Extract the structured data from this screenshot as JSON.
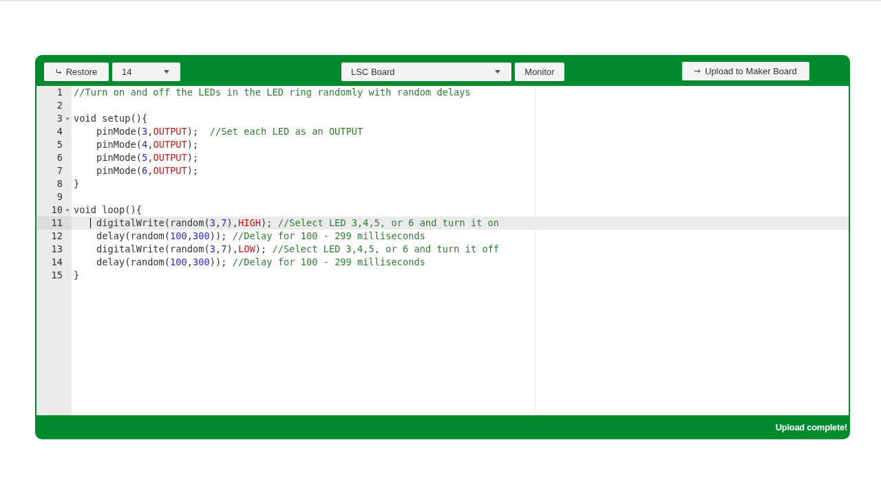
{
  "toolbar": {
    "restore_button": "Restore",
    "line_select": "14",
    "board_select": "LSC Board",
    "monitor_button": "Monitor",
    "upload_button": "Upload to Maker Board"
  },
  "editor": {
    "lines": [
      {
        "number": "1",
        "selected": false,
        "tokens": [
          {
            "text": "//Turn on and off the LEDs in the LED ring randomly with random delays",
            "kind": "comment"
          }
        ]
      },
      {
        "number": "2",
        "selected": false
      },
      {
        "number": "3",
        "selected": false,
        "expanded": true,
        "tokens": [
          {
            "text": "void setup(){",
            "kind": "plain"
          }
        ]
      },
      {
        "number": "4",
        "selected": false,
        "tokens": [
          {
            "text": "    pinMode(",
            "kind": "plain"
          },
          {
            "text": "3",
            "kind": "number"
          },
          {
            "text": ",",
            "kind": "plain"
          },
          {
            "text": "OUTPUT",
            "kind": "constant"
          },
          {
            "text": ");  ",
            "kind": "plain"
          },
          {
            "text": "//Set each LED as an OUTPUT",
            "kind": "comment"
          }
        ]
      },
      {
        "number": "5",
        "selected": false,
        "tokens": [
          {
            "text": "    pinMode(",
            "kind": "plain"
          },
          {
            "text": "4",
            "kind": "number"
          },
          {
            "text": ",",
            "kind": "plain"
          },
          {
            "text": "OUTPUT",
            "kind": "constant"
          },
          {
            "text": ");",
            "kind": "plain"
          }
        ]
      },
      {
        "number": "6",
        "selected": false,
        "tokens": [
          {
            "text": "    pinMode(",
            "kind": "plain"
          },
          {
            "text": "5",
            "kind": "number"
          },
          {
            "text": ",",
            "kind": "plain"
          },
          {
            "text": "OUTPUT",
            "kind": "constant"
          },
          {
            "text": ");",
            "kind": "plain"
          }
        ]
      },
      {
        "number": "7",
        "selected": false,
        "tokens": [
          {
            "text": "    pinMode(",
            "kind": "plain"
          },
          {
            "text": "6",
            "kind": "number"
          },
          {
            "text": ",",
            "kind": "plain"
          },
          {
            "text": "OUTPUT",
            "kind": "constant"
          },
          {
            "text": ");",
            "kind": "plain"
          }
        ]
      },
      {
        "number": "8",
        "selected": false,
        "tokens": [
          {
            "text": "}",
            "kind": "plain"
          }
        ]
      },
      {
        "number": "9",
        "selected": false
      },
      {
        "number": "10",
        "selected": false,
        "expanded": true,
        "tokens": [
          {
            "text": "void loop(){",
            "kind": "plain"
          }
        ]
      },
      {
        "number": "11",
        "selected": true,
        "tokens": [
          {
            "text": "    digitalWrite(random(",
            "kind": "plain"
          },
          {
            "text": "3",
            "kind": "number"
          },
          {
            "text": ",",
            "kind": "plain"
          },
          {
            "text": "7",
            "kind": "number"
          },
          {
            "text": "),",
            "kind": "plain"
          },
          {
            "text": "HIGH",
            "kind": "constant"
          },
          {
            "text": "); ",
            "kind": "plain"
          },
          {
            "text": "//Select LED 3,4,5, or 6 and turn it on",
            "kind": "comment"
          }
        ]
      },
      {
        "number": "12",
        "selected": false,
        "tokens": [
          {
            "text": "    delay(random(",
            "kind": "plain"
          },
          {
            "text": "100",
            "kind": "number"
          },
          {
            "text": ",",
            "kind": "plain"
          },
          {
            "text": "300",
            "kind": "number"
          },
          {
            "text": ")); ",
            "kind": "plain"
          },
          {
            "text": "//Delay for 100 - 299 milliseconds",
            "kind": "comment"
          }
        ]
      },
      {
        "number": "13",
        "selected": false,
        "tokens": [
          {
            "text": "    digitalWrite(random(",
            "kind": "plain"
          },
          {
            "text": "3",
            "kind": "number"
          },
          {
            "text": ",",
            "kind": "plain"
          },
          {
            "text": "7",
            "kind": "number"
          },
          {
            "text": "),",
            "kind": "plain"
          },
          {
            "text": "LOW",
            "kind": "constant"
          },
          {
            "text": "); ",
            "kind": "plain"
          },
          {
            "text": "//Select LED 3,4,5, or 6 and turn it off",
            "kind": "comment"
          }
        ]
      },
      {
        "number": "14",
        "selected": false,
        "tokens": [
          {
            "text": "    delay(random(",
            "kind": "plain"
          },
          {
            "text": "100",
            "kind": "number"
          },
          {
            "text": ",",
            "kind": "plain"
          },
          {
            "text": "300",
            "kind": "number"
          },
          {
            "text": ")); ",
            "kind": "plain"
          },
          {
            "text": "//Delay for 100 - 299 milliseconds",
            "kind": "comment"
          }
        ]
      },
      {
        "number": "15",
        "selected": false,
        "tokens": [
          {
            "text": "}",
            "kind": "plain"
          }
        ]
      }
    ]
  },
  "status_bar": {
    "message": "Upload complete!"
  }
}
